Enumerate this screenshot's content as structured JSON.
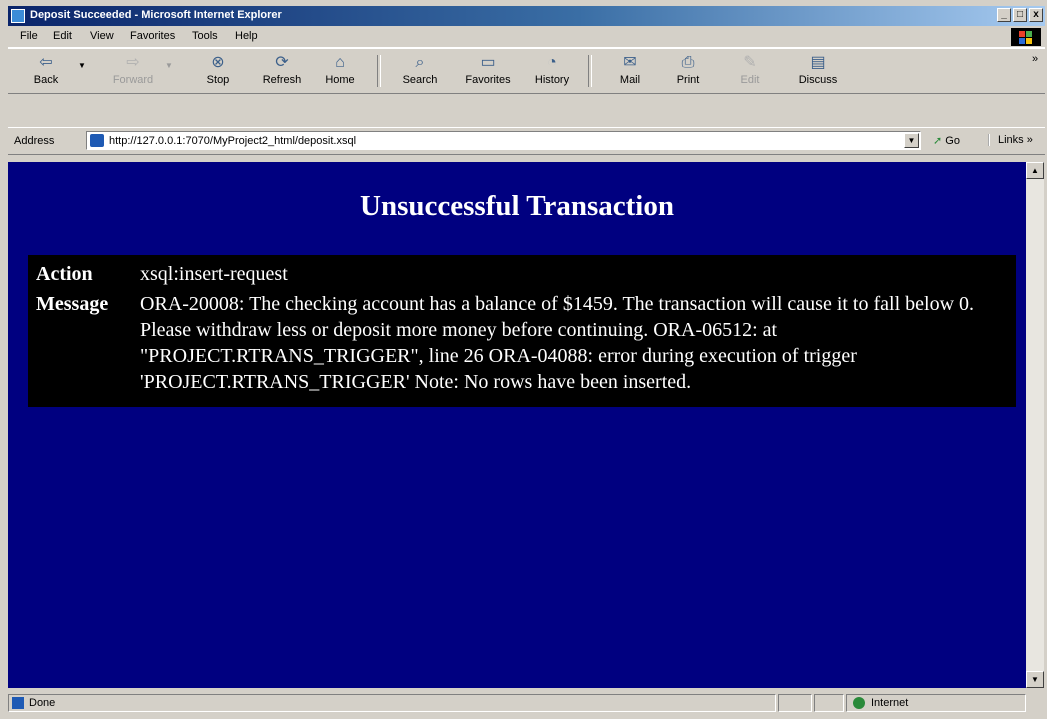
{
  "window": {
    "title": "Deposit Succeeded - Microsoft Internet Explorer",
    "controls": [
      "_",
      "□",
      "x"
    ]
  },
  "menu": {
    "items": [
      "File",
      "Edit",
      "View",
      "Favorites",
      "Tools",
      "Help"
    ]
  },
  "toolbar": {
    "back": "Back",
    "forward": "Forward",
    "stop": "Stop",
    "refresh": "Refresh",
    "home": "Home",
    "search": "Search",
    "favorites": "Favorites",
    "history": "History",
    "mail": "Mail",
    "print": "Print",
    "edit": "Edit",
    "discuss": "Discuss",
    "more": "»"
  },
  "address": {
    "label": "Address",
    "url": "http://127.0.0.1:7070/MyProject2_html/deposit.xsql",
    "go": "Go",
    "links": "Links »"
  },
  "page": {
    "heading": "Unsuccessful Transaction",
    "rows": [
      {
        "label": "Action",
        "value": "xsql:insert-request"
      },
      {
        "label": "Message",
        "value": "ORA-20008: The checking account has a balance of $1459. The transaction will cause it to fall below 0. Please withdraw less or deposit more money before continuing. ORA-06512: at \"PROJECT.RTRANS_TRIGGER\", line 26 ORA-04088: error during execution of trigger 'PROJECT.RTRANS_TRIGGER' Note: No rows have been inserted."
      }
    ]
  },
  "status": {
    "text": "Done",
    "zone": "Internet"
  },
  "colors": {
    "page_background": "#000080",
    "table_background": "#000000",
    "text": "#ffffff"
  }
}
